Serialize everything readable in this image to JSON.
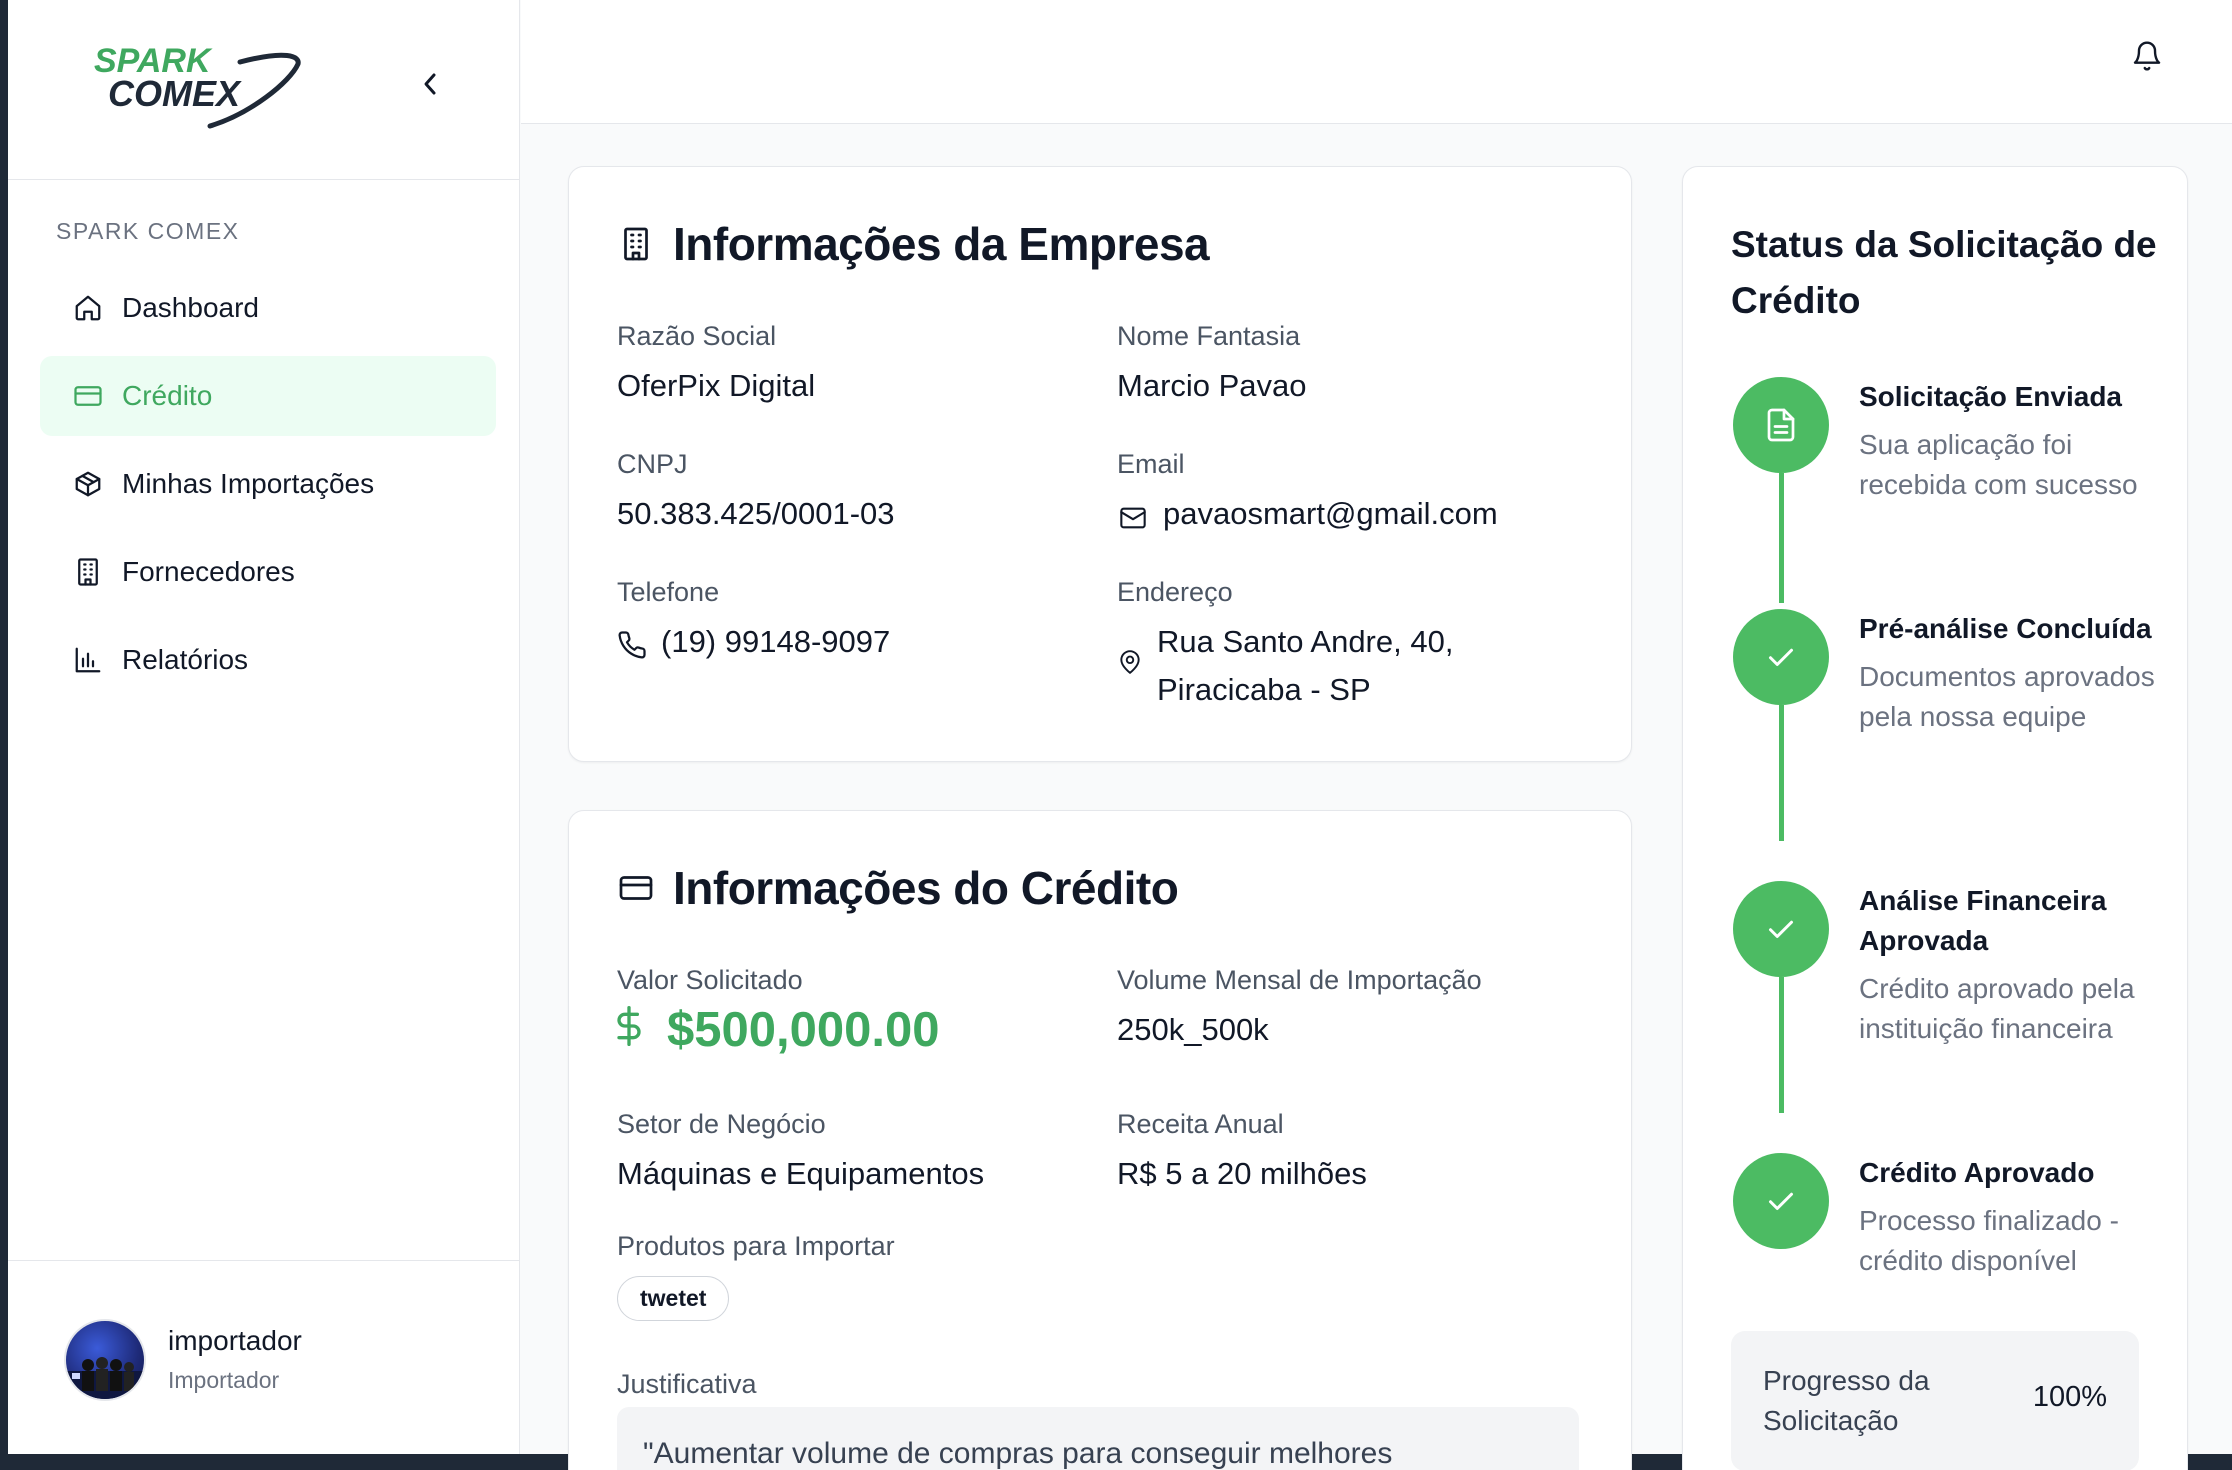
{
  "brand": {
    "logo_line1": "SPARK",
    "logo_line2": "COMEX",
    "section_title": "SPARK COMEX",
    "accent": "#3fa85f"
  },
  "sidebar": {
    "items": [
      {
        "label": "Dashboard",
        "icon": "home-icon",
        "active": false
      },
      {
        "label": "Crédito",
        "icon": "credit-card-icon",
        "active": true
      },
      {
        "label": "Minhas Importações",
        "icon": "package-icon",
        "active": false
      },
      {
        "label": "Fornecedores",
        "icon": "building-icon",
        "active": false
      },
      {
        "label": "Relatórios",
        "icon": "bar-chart-icon",
        "active": false
      }
    ]
  },
  "user": {
    "name": "importador",
    "role": "Importador"
  },
  "company": {
    "title": "Informações da Empresa",
    "razao_label": "Razão Social",
    "razao_value": "OferPix Digital",
    "fantasia_label": "Nome Fantasia",
    "fantasia_value": "Marcio Pavao",
    "cnpj_label": "CNPJ",
    "cnpj_value": "50.383.425/0001-03",
    "email_label": "Email",
    "email_value": "pavaosmart@gmail.com",
    "phone_label": "Telefone",
    "phone_value": "(19) 99148-9097",
    "address_label": "Endereço",
    "address_line1": "Rua Santo Andre, 40,",
    "address_line2": "Piracicaba - SP"
  },
  "credit": {
    "title": "Informações do Crédito",
    "valor_label": "Valor Solicitado",
    "valor_value": "$500,000.00",
    "volume_label": "Volume Mensal de Importação",
    "volume_value": "250k_500k",
    "setor_label": "Setor de Negócio",
    "setor_value": "Máquinas e Equipamentos",
    "receita_label": "Receita Anual",
    "receita_value": "R$ 5 a 20 milhões",
    "produtos_label": "Produtos para Importar",
    "produtos_tag": "twetet",
    "justificativa_label": "Justificativa",
    "justificativa_value": "\"Aumentar volume de compras para conseguir melhores"
  },
  "status": {
    "title": "Status da Solicitação de Crédito",
    "steps": [
      {
        "title": "Solicitação Enviada",
        "desc": "Sua aplicação foi recebida com sucesso",
        "icon": "document-icon"
      },
      {
        "title": "Pré-análise Concluída",
        "desc": "Documentos aprovados pela nossa equipe",
        "icon": "check-icon"
      },
      {
        "title": "Análise Financeira Aprovada",
        "desc": "Crédito aprovado pela instituição financeira",
        "icon": "check-icon"
      },
      {
        "title": "Crédito Aprovado",
        "desc": "Processo finalizado - crédito disponível",
        "icon": "check-icon"
      }
    ],
    "progress_label": "Progresso da Solicitação",
    "progress_value": "100%"
  }
}
